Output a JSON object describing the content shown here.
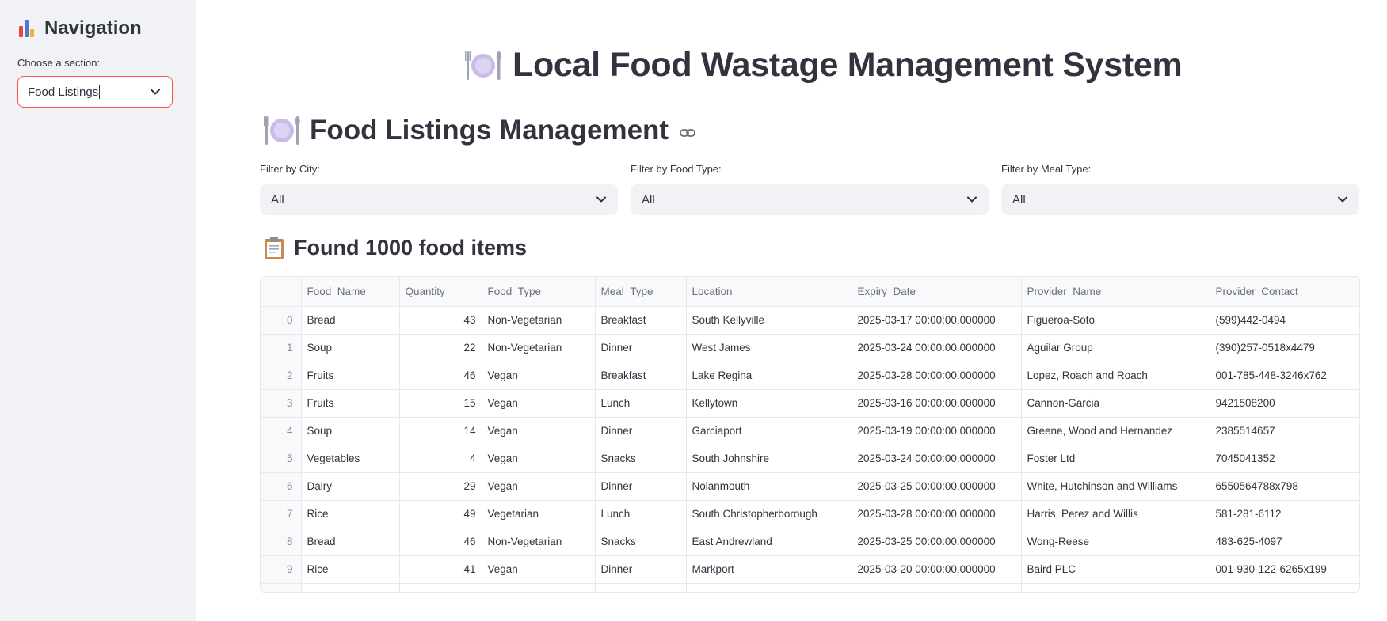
{
  "sidebar": {
    "title": "Navigation",
    "section_label": "Choose a section:",
    "section_value": "Food Listings"
  },
  "main": {
    "title": "Local Food Wastage Management System",
    "subtitle": "Food Listings Management",
    "filters": [
      {
        "label": "Filter by City:",
        "value": "All"
      },
      {
        "label": "Filter by Food Type:",
        "value": "All"
      },
      {
        "label": "Filter by Meal Type:",
        "value": "All"
      }
    ],
    "found_text": "Found 1000 food items"
  },
  "table": {
    "columns": [
      "",
      "Food_Name",
      "Quantity",
      "Food_Type",
      "Meal_Type",
      "Location",
      "Expiry_Date",
      "Provider_Name",
      "Provider_Contact"
    ],
    "rows": [
      [
        "0",
        "Bread",
        "43",
        "Non-Vegetarian",
        "Breakfast",
        "South Kellyville",
        "2025-03-17 00:00:00.000000",
        "Figueroa-Soto",
        "(599)442-0494"
      ],
      [
        "1",
        "Soup",
        "22",
        "Non-Vegetarian",
        "Dinner",
        "West James",
        "2025-03-24 00:00:00.000000",
        "Aguilar Group",
        "(390)257-0518x4479"
      ],
      [
        "2",
        "Fruits",
        "46",
        "Vegan",
        "Breakfast",
        "Lake Regina",
        "2025-03-28 00:00:00.000000",
        "Lopez, Roach and Roach",
        "001-785-448-3246x762"
      ],
      [
        "3",
        "Fruits",
        "15",
        "Vegan",
        "Lunch",
        "Kellytown",
        "2025-03-16 00:00:00.000000",
        "Cannon-Garcia",
        "9421508200"
      ],
      [
        "4",
        "Soup",
        "14",
        "Vegan",
        "Dinner",
        "Garciaport",
        "2025-03-19 00:00:00.000000",
        "Greene, Wood and Hernandez",
        "2385514657"
      ],
      [
        "5",
        "Vegetables",
        "4",
        "Vegan",
        "Snacks",
        "South Johnshire",
        "2025-03-24 00:00:00.000000",
        "Foster Ltd",
        "7045041352"
      ],
      [
        "6",
        "Dairy",
        "29",
        "Vegan",
        "Dinner",
        "Nolanmouth",
        "2025-03-25 00:00:00.000000",
        "White, Hutchinson and Williams",
        "6550564788x798"
      ],
      [
        "7",
        "Rice",
        "49",
        "Vegetarian",
        "Lunch",
        "South Christopherborough",
        "2025-03-28 00:00:00.000000",
        "Harris, Perez and Willis",
        "581-281-6112"
      ],
      [
        "8",
        "Bread",
        "46",
        "Non-Vegetarian",
        "Snacks",
        "East Andrewland",
        "2025-03-25 00:00:00.000000",
        "Wong-Reese",
        "483-625-4097"
      ],
      [
        "9",
        "Rice",
        "41",
        "Vegan",
        "Dinner",
        "Markport",
        "2025-03-20 00:00:00.000000",
        "Baird PLC",
        "001-930-122-6265x199"
      ]
    ]
  },
  "icons": {
    "nav": "bar-chart-icon",
    "title": "plate-with-cutlery-icon",
    "subtitle": "plate-with-cutlery-icon",
    "link": "link-icon",
    "found": "clipboard-icon",
    "dropdown": "chevron-down-icon"
  },
  "colors": {
    "sidebar_bg": "#f0f2f6",
    "accent": "#ff4b4b",
    "text": "#31333f",
    "select_bg": "#f0f2f6"
  }
}
